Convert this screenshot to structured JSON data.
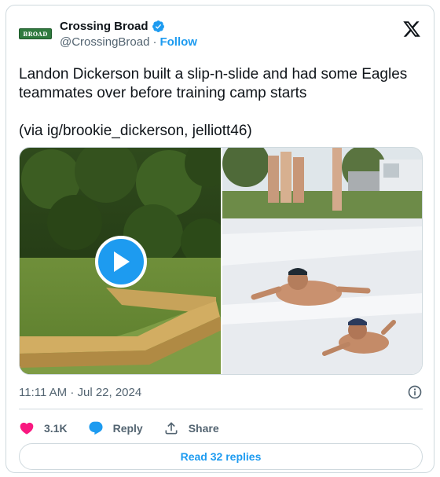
{
  "author": {
    "display_name": "Crossing Broad",
    "handle": "@CrossingBroad",
    "separator": "·",
    "follow_label": "Follow",
    "avatar_text": "BROAD",
    "verified": true,
    "verified_color": "#1d9bf0"
  },
  "tweet": {
    "text": "Landon Dickerson built a slip-n-slide and had some Eagles teammates over before training camp starts\n\n(via ig/brookie_dickerson, jelliott46)"
  },
  "media": {
    "left": {
      "type": "video",
      "icon": "play-icon"
    },
    "right": {
      "type": "photo"
    }
  },
  "meta": {
    "timestamp": "11:11 AM · Jul 22, 2024"
  },
  "actions": {
    "like_count": "3.1K",
    "reply_label": "Reply",
    "share_label": "Share",
    "like_color": "#f91880",
    "reply_color": "#1d9bf0"
  },
  "read_replies_label": "Read 32 replies",
  "colors": {
    "accent": "#1d9bf0",
    "text": "#0f1419",
    "muted": "#536471",
    "border": "#cfd9de"
  }
}
